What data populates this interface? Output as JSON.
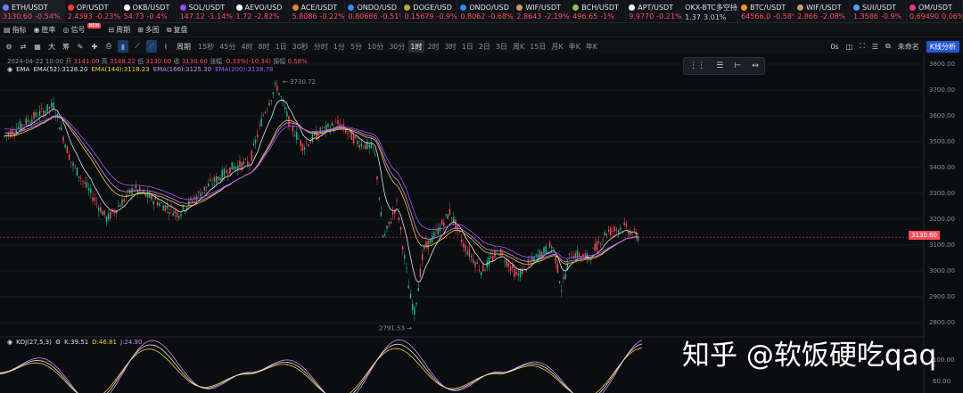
{
  "tickers": [
    {
      "sym": "ETH/USDT",
      "price": "3130.60",
      "chg": "-0.54%",
      "dir": "down",
      "dot": "#6d7cff"
    },
    {
      "sym": "OP/USDT",
      "price": "2.4393",
      "chg": "-0.23%",
      "dir": "down",
      "dot": "#ff3b3b"
    },
    {
      "sym": "OKB/USDT",
      "price": "54.73",
      "chg": "-0.4%",
      "dir": "down",
      "dot": "#ffffff"
    },
    {
      "sym": "SOL/USDT",
      "price": "147.12",
      "chg": "-1.14%",
      "dir": "down",
      "dot": "#9945ff"
    },
    {
      "sym": "AEVO/USD",
      "price": "1.72",
      "chg": "-2.82%",
      "dir": "down",
      "dot": "#ffffff"
    },
    {
      "sym": "ACE/USDT",
      "price": "5.8086",
      "chg": "-0.22%",
      "dir": "down",
      "dot": "#d28b2c"
    },
    {
      "sym": "ONDO/USD",
      "price": "0.80686",
      "chg": "-0.51%",
      "dir": "down",
      "dot": "#2e8bff"
    },
    {
      "sym": "DOGE/USD",
      "price": "0.15679",
      "chg": "-0.9%",
      "dir": "down",
      "dot": "#c2a633"
    },
    {
      "sym": "ONDO/USD",
      "price": "0.8062",
      "chg": "-0.68%",
      "dir": "down",
      "dot": "#2e8bff"
    },
    {
      "sym": "WIF/USDT",
      "price": "2.8643",
      "chg": "-2.19%",
      "dir": "down",
      "dot": "#c79b6b"
    },
    {
      "sym": "BCH/USDT",
      "price": "496.65",
      "chg": "-1%",
      "dir": "down",
      "dot": "#8dc351"
    },
    {
      "sym": "APT/USDT",
      "price": "9.9770",
      "chg": "-0.21%",
      "dir": "down",
      "dot": "#ffffff"
    },
    {
      "sym": "OKX-BTC多空持",
      "price": "1.37",
      "chg": "3.01%",
      "dir": "flat",
      "dot": ""
    },
    {
      "sym": "BTC/USDT",
      "price": "64566.0",
      "chg": "-0.58%",
      "dir": "down",
      "dot": "#f7931a"
    },
    {
      "sym": "WIF/USDT",
      "price": "2.866",
      "chg": "-2.08%",
      "dir": "down",
      "dot": "#c79b6b"
    },
    {
      "sym": "SUI/USDT",
      "price": "1.3586",
      "chg": "-0.9%",
      "dir": "down",
      "dot": "#4da2ff"
    },
    {
      "sym": "OM/USDT",
      "price": "0.69490",
      "chg": "0.06%",
      "dir": "down",
      "dot": "#e23a8f"
    }
  ],
  "toolbar": {
    "indicator": "指标",
    "win_rate": "胜率",
    "signal": "信号",
    "new_badge": "NEW",
    "cycle": "周期",
    "multi": "多图",
    "replay": "复盘",
    "period": "周期"
  },
  "toolbar2_icons": [
    "大",
    "筹"
  ],
  "timeframes": [
    "15秒",
    "45分",
    "4时",
    "8时",
    "1日",
    "30秒",
    "分时",
    "1分",
    "5分",
    "10分",
    "30分",
    "1时",
    "2时",
    "3时",
    "1日",
    "2日",
    "3日",
    "周K",
    "15日",
    "月K",
    "季K",
    "年K"
  ],
  "selected_timeframe": "1时",
  "right_controls": {
    "zero_s": "0s",
    "unnamed": "未命名",
    "kline_button": "K线分析"
  },
  "ohlc": {
    "date": "2024-04-22 10:00",
    "open_l": "开",
    "open": "3141.00",
    "high_l": "高",
    "high": "3148.22",
    "low_l": "低",
    "low": "3130.00",
    "close_l": "收",
    "close": "3130.60",
    "chg_l": "涨幅",
    "chg": "-0.33%(-10.34)",
    "amp_l": "振幅",
    "amp": "0.58%"
  },
  "ema": {
    "label": "EMA",
    "ema52": "EMA(52):3128.20",
    "ema144": "EMA(144):3118.23",
    "ema166": "EMA(166):3125.30",
    "ema200": "EMA(200):3138.78"
  },
  "kdj": {
    "label": "KDJ(27,5,3)",
    "k": "K:39.51",
    "d": "D:46.81",
    "j": "J:24.90"
  },
  "y_axis": [
    "3800.00",
    "3700.00",
    "3600.00",
    "3500.00",
    "3400.00",
    "3300.00",
    "3200.00",
    "3100.00",
    "3000.00",
    "2900.00",
    "2800.00"
  ],
  "kdj_axis": [
    "100.00",
    "60.00"
  ],
  "annotations": {
    "high": "3730.72",
    "low": "2791.53",
    "current": "3130.60"
  },
  "watermark": "知乎 @软饭硬吃qaq",
  "colors": {
    "up": "#1fc087",
    "down": "#ff4d5e",
    "ema52": "#e2e4e8",
    "ema144": "#f5d041",
    "ema166": "#d58cf0",
    "ema200": "#a15cf0"
  }
}
